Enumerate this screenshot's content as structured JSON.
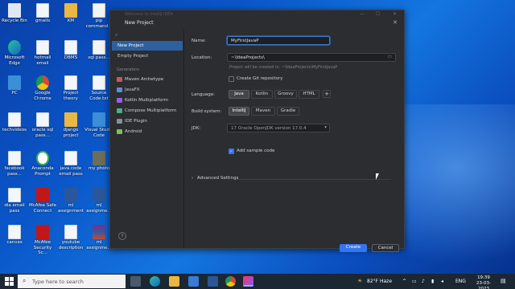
{
  "desktop": {
    "icons": [
      {
        "label": "Recycle Bin"
      },
      {
        "label": "gmails"
      },
      {
        "label": "KM"
      },
      {
        "label": "pip command..."
      },
      {
        "label": "Microsoft Edge"
      },
      {
        "label": "hotmail email"
      },
      {
        "label": "DBMS"
      },
      {
        "label": "sql pass..."
      },
      {
        "label": "PC"
      },
      {
        "label": "Google Chrome"
      },
      {
        "label": "Project theory"
      },
      {
        "label": "Source Code.txt"
      },
      {
        "label": "techvideos"
      },
      {
        "label": "oracle sql pass..."
      },
      {
        "label": "django project"
      },
      {
        "label": "Visual Studio Code"
      },
      {
        "label": "facebook pass..."
      },
      {
        "label": "Anaconda Prompt"
      },
      {
        "label": "java code email pass"
      },
      {
        "label": "my photo"
      },
      {
        "label": "dia email pass"
      },
      {
        "label": "McAfee Safe Connect"
      },
      {
        "label": "ml assignment"
      },
      {
        "label": "ml assignme..."
      },
      {
        "label": "canvas"
      },
      {
        "label": "McAfee Security Sc..."
      },
      {
        "label": "youtube description"
      },
      {
        "label": "ml assignme..."
      }
    ]
  },
  "window": {
    "ghost_title": "Welcome to IntelliJ IDEA",
    "dialog_title": "New Project",
    "sidebar": {
      "search_icon": "search-icon",
      "items": [
        {
          "label": "New Project"
        },
        {
          "label": "Empty Project"
        }
      ],
      "generators_header": "Generators",
      "generators": [
        {
          "label": "Maven Archetype",
          "color": "#c35b5b"
        },
        {
          "label": "JavaFX",
          "color": "#5b8ed6"
        },
        {
          "label": "Kotlin Multiplatform",
          "color": "#9b5de5"
        },
        {
          "label": "Compose Multiplatform",
          "color": "#4caf83"
        },
        {
          "label": "IDE Plugin",
          "color": "#8a8f97"
        },
        {
          "label": "Android",
          "color": "#78c257"
        }
      ]
    },
    "form": {
      "name_label": "Name:",
      "name_value": "MyFirstJavaP",
      "location_label": "Location:",
      "location_value": "~\\IdeaProjects\\",
      "location_hint": "Project will be created in: ~\\IdeaProjects\\MyFirstJavaP",
      "git_label": "Create Git repository",
      "language_label": "Language:",
      "languages": [
        {
          "label": "Java"
        },
        {
          "label": "Kotlin"
        },
        {
          "label": "Groovy"
        },
        {
          "label": "HTML"
        }
      ],
      "language_add": "+",
      "build_label": "Build system:",
      "build_systems": [
        {
          "label": "IntelliJ"
        },
        {
          "label": "Maven"
        },
        {
          "label": "Gradle"
        }
      ],
      "jdk_label": "JDK:",
      "jdk_value": "17 Oracle OpenJDK version 17.0.4",
      "sample_label": "Add sample code",
      "advanced_label": "Advanced Settings"
    },
    "buttons": {
      "help": "?",
      "create": "Create",
      "cancel": "Cancel"
    }
  },
  "taskbar": {
    "search_placeholder": "Type here to search",
    "weather": "82°F  Haze",
    "language": "ENG",
    "time": "19:39",
    "date": "23-03-2023"
  },
  "colors": {
    "accent": "#3574f0",
    "selection": "#2e5f9e",
    "ide_bg": "#2b2d30"
  }
}
